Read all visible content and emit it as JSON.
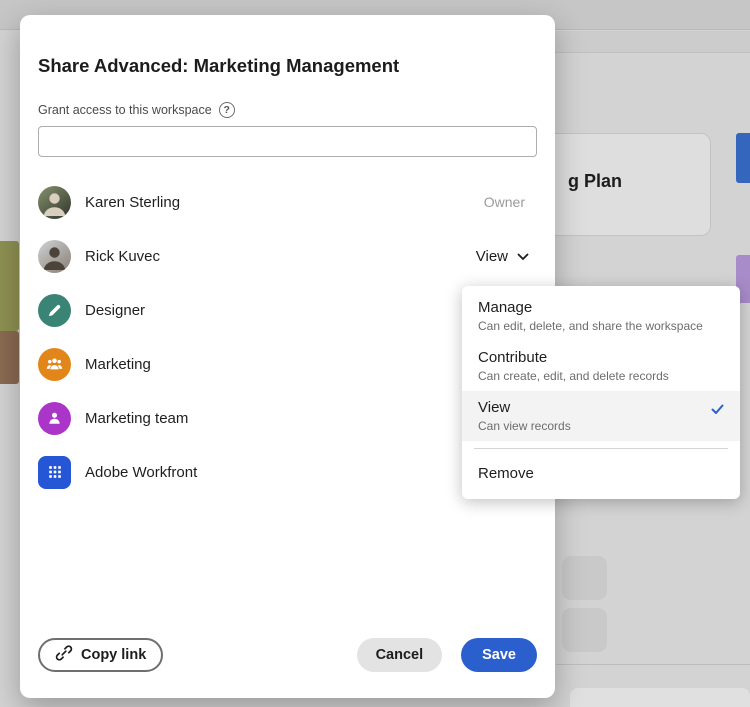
{
  "colors": {
    "accent": "#2B5FCE"
  },
  "background": {
    "card_text": "g Plan"
  },
  "modal": {
    "title": "Share Advanced: Marketing Management",
    "grant_label": "Grant access to this workspace",
    "help_glyph": "?",
    "members": [
      {
        "name": "Karen Sterling",
        "role": "Owner"
      },
      {
        "name": "Rick Kuvec",
        "role": "View"
      },
      {
        "name": "Designer",
        "role": ""
      },
      {
        "name": "Marketing",
        "role": ""
      },
      {
        "name": "Marketing team",
        "role": ""
      },
      {
        "name": "Adobe Workfront",
        "role": ""
      }
    ],
    "footer": {
      "copy_link": "Copy link",
      "cancel": "Cancel",
      "save": "Save"
    }
  },
  "dropdown": {
    "items": [
      {
        "label": "Manage",
        "description": "Can edit, delete, and share the workspace",
        "selected": false
      },
      {
        "label": "Contribute",
        "description": "Can create, edit, and delete records",
        "selected": false
      },
      {
        "label": "View",
        "description": "Can view records",
        "selected": true
      },
      {
        "label": "Remove",
        "description": "",
        "selected": false
      }
    ]
  }
}
